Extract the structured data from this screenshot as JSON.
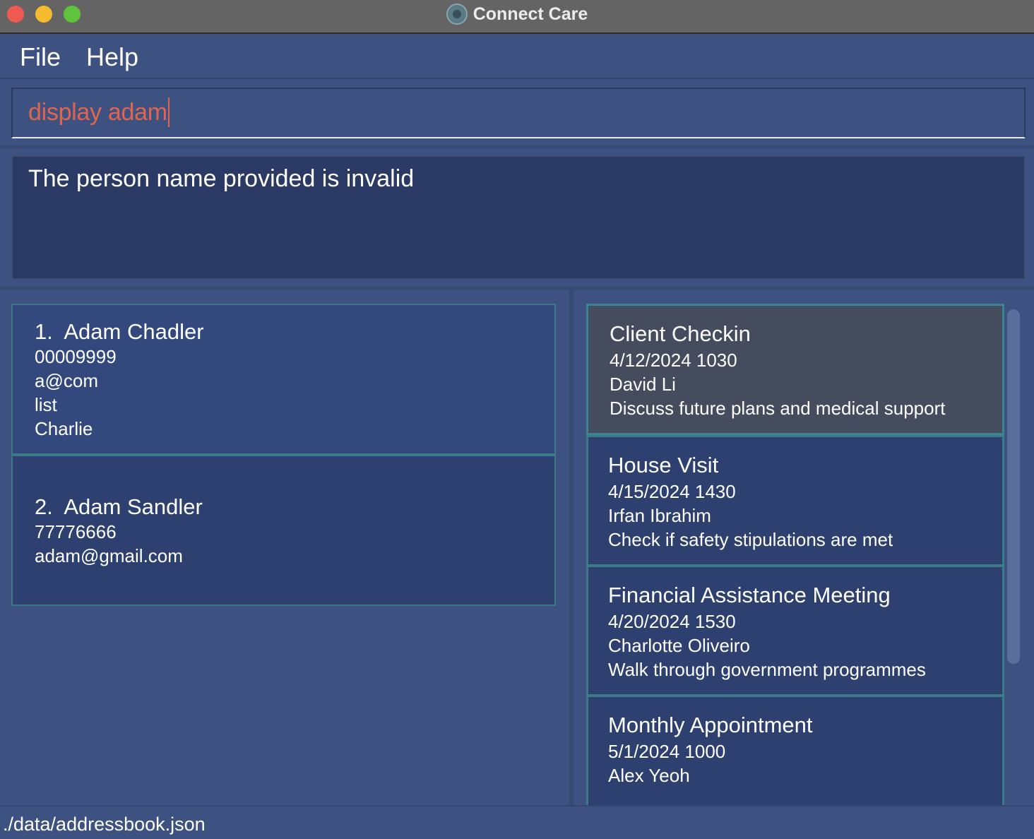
{
  "window": {
    "title": "Connect Care"
  },
  "menu": {
    "file": "File",
    "help": "Help"
  },
  "command": {
    "value": "display adam"
  },
  "result": {
    "message": "The person name provided is invalid"
  },
  "persons": [
    {
      "index": "1.",
      "name": "Adam Chadler",
      "lines": [
        "00009999",
        "a@com",
        "list",
        "Charlie"
      ]
    },
    {
      "index": "2.",
      "name": "Adam Sandler",
      "lines": [
        "77776666",
        "adam@gmail.com"
      ]
    }
  ],
  "appointments": [
    {
      "title": "Client Checkin",
      "datetime": "4/12/2024 1030",
      "client": "David Li",
      "description": "Discuss future plans and medical support",
      "selected": true
    },
    {
      "title": "House Visit",
      "datetime": "4/15/2024 1430",
      "client": "Irfan Ibrahim",
      "description": "Check if safety stipulations are met"
    },
    {
      "title": "Financial Assistance Meeting",
      "datetime": "4/20/2024 1530",
      "client": "Charlotte Oliveiro",
      "description": "Walk through government programmes"
    },
    {
      "title": "Monthly Appointment",
      "datetime": "5/1/2024 1000",
      "client": "Alex Yeoh"
    }
  ],
  "status": {
    "file_path": "./data/addressbook.json"
  }
}
